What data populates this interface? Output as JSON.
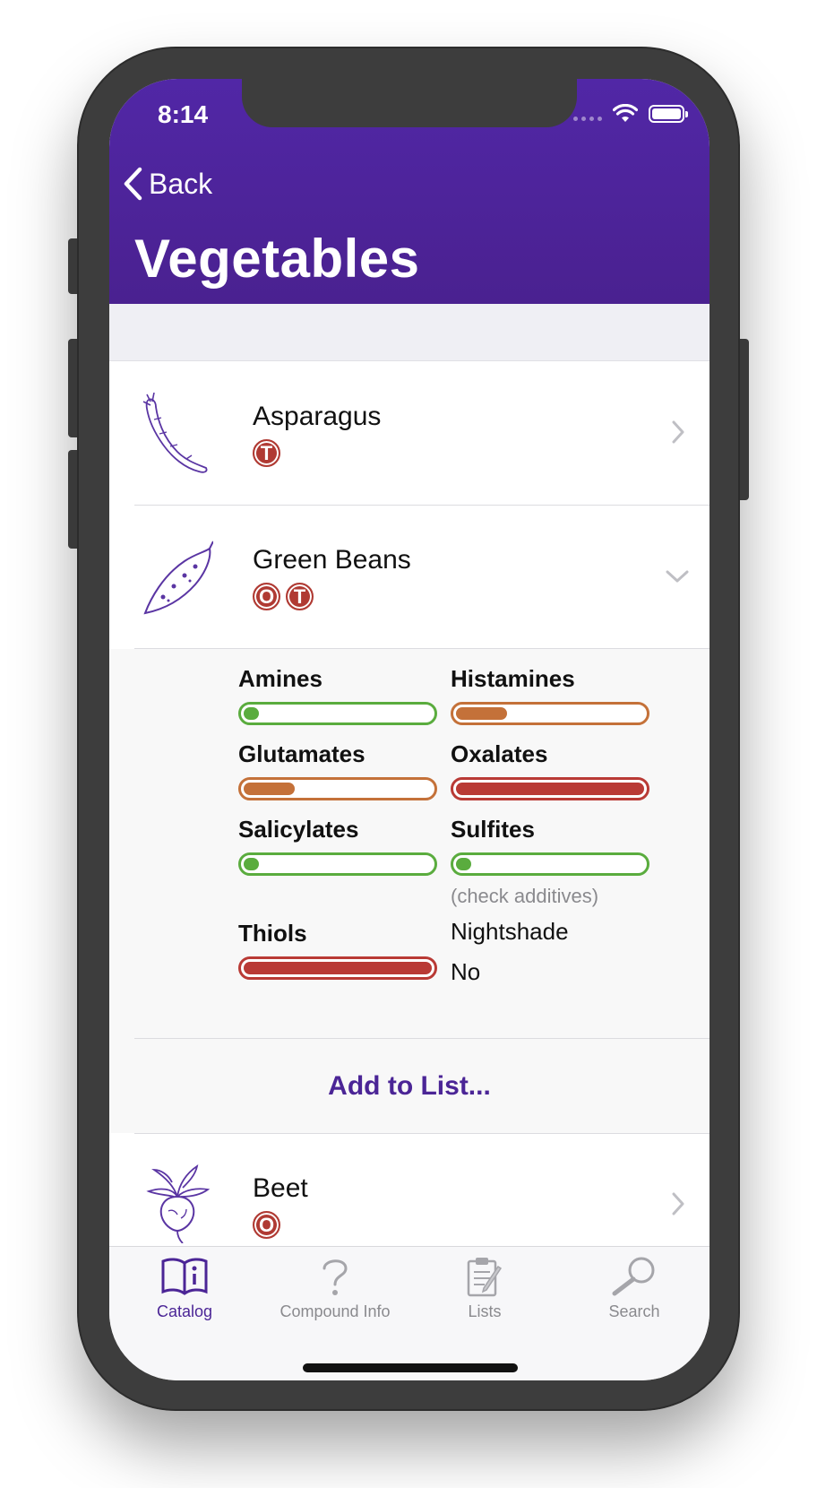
{
  "status": {
    "time": "8:14"
  },
  "nav": {
    "back_label": "Back",
    "title": "Vegetables"
  },
  "items": [
    {
      "name": "Asparagus",
      "badges": [
        "T"
      ],
      "indicator": "chevron-right"
    },
    {
      "name": "Green Beans",
      "badges": [
        "O",
        "T"
      ],
      "indicator": "chevron-down"
    },
    {
      "name": "Beet",
      "badges": [
        "O"
      ],
      "indicator": "chevron-right"
    }
  ],
  "detail": {
    "amines": {
      "label": "Amines",
      "level": 0.08,
      "color": "#5aac3e"
    },
    "histamines": {
      "label": "Histamines",
      "level": 0.27,
      "color": "#c47139"
    },
    "glutamates": {
      "label": "Glutamates",
      "level": 0.27,
      "color": "#c47139"
    },
    "oxalates": {
      "label": "Oxalates",
      "level": 1.0,
      "color": "#b93a35"
    },
    "salicylates": {
      "label": "Salicylates",
      "level": 0.08,
      "color": "#5aac3e"
    },
    "sulfites": {
      "label": "Sulfites",
      "level": 0.08,
      "color": "#5aac3e",
      "note": "(check additives)"
    },
    "thiols": {
      "label": "Thiols",
      "level": 1.0,
      "color": "#b93a35"
    },
    "nightshade": {
      "label": "Nightshade",
      "value": "No"
    },
    "add_to_list": "Add to List..."
  },
  "tabs": [
    {
      "label": "Catalog",
      "icon": "book-icon",
      "active": true
    },
    {
      "label": "Compound Info",
      "icon": "question-icon",
      "active": false
    },
    {
      "label": "Lists",
      "icon": "clipboard-icon",
      "active": false
    },
    {
      "label": "Search",
      "icon": "magnifier-icon",
      "active": false
    }
  ],
  "colors": {
    "accent": "#4b2596",
    "header": "#5127a6",
    "badge": "#b03a33"
  }
}
